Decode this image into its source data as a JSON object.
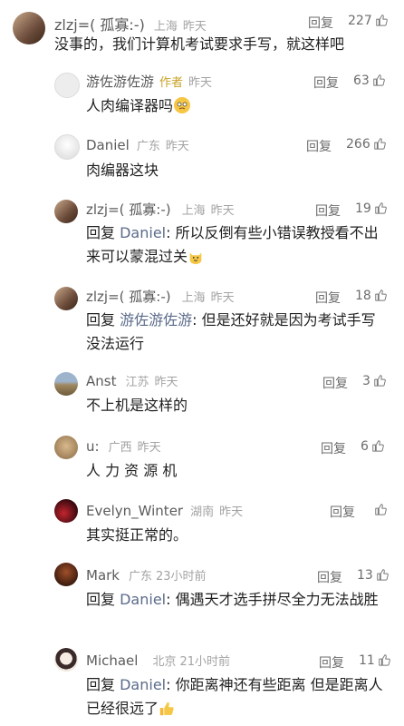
{
  "comments": [
    {
      "user": "zlzj=( 孤寡:-)",
      "location": "上海",
      "time": "昨天",
      "reply": "回复",
      "likes": "227",
      "text": "没事的，我们计算机考试要求手写，就这样吧",
      "avatar": "#6b4b3a"
    },
    {
      "user": "游佐游佐游",
      "badge": "作者",
      "location": "",
      "time": "昨天",
      "reply": "回复",
      "likes": "63",
      "text": "人肉编译器吗",
      "avatar": "#ededed"
    },
    {
      "user": "Daniel",
      "location": "广东",
      "time": "昨天",
      "reply": "回复",
      "likes": "266",
      "text": "肉编器这块",
      "avatar": "#f2f2f2"
    },
    {
      "user": "zlzj=( 孤寡:-)",
      "location": "上海",
      "time": "昨天",
      "reply": "回复",
      "likes": "19",
      "prefix": "回复",
      "target": "Daniel",
      "text": ": 所以反倒有些小错误教授看不出来可以蒙混过关",
      "avatar": "#6b4b3a"
    },
    {
      "user": "zlzj=( 孤寡:-)",
      "location": "上海",
      "time": "昨天",
      "reply": "回复",
      "likes": "18",
      "prefix": "回复",
      "target": "游佐游佐游",
      "text": ": 但是还好就是因为考试手写没法运行",
      "avatar": "#6b4b3a"
    },
    {
      "user": "Anst",
      "location": "江苏",
      "time": "昨天",
      "reply": "回复",
      "likes": "3",
      "text": "不上机是这样的",
      "avatar": "#8c7a55"
    },
    {
      "user": "u:",
      "location": "广西",
      "time": "昨天",
      "reply": "回复",
      "likes": "6",
      "text": "人 力 资 源 机",
      "avatar": "#b59263"
    },
    {
      "user": "Evelyn_Winter",
      "location": "湖南",
      "time": "昨天",
      "reply": "回复",
      "likes": "",
      "text": "其实挺正常的。",
      "avatar": "#7a1420"
    },
    {
      "user": "Mark",
      "location": "广东",
      "time": "23小时前",
      "reply": "回复",
      "likes": "13",
      "prefix": "回复",
      "target": "Daniel",
      "text": ": 偶遇天才选手拼尽全力无法战胜",
      "avatar": "#5a2d1a"
    },
    {
      "user": "Michael",
      "location": "北京",
      "time": "21小时前",
      "reply": "回复",
      "likes": "11",
      "prefix": "回复",
      "target": "Daniel",
      "text": ": 你距离神还有些距离 但是距离人已经很远了",
      "avatar": "#f0e8e0"
    }
  ]
}
